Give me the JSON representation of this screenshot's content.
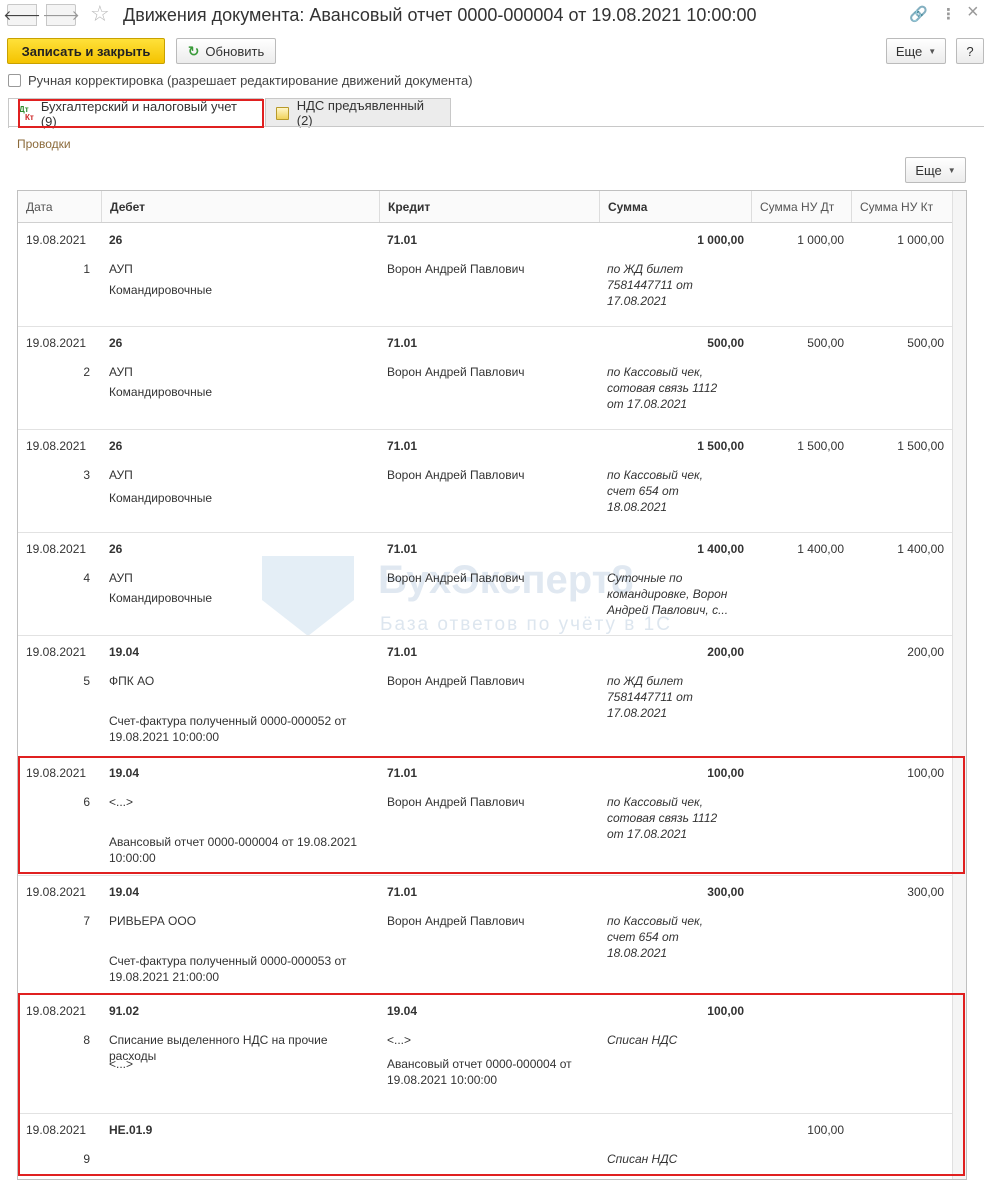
{
  "window": {
    "title": "Движения документа: Авансовый отчет 0000-000004 от 19.08.2021 10:00:00",
    "back_icon": "🡐",
    "forward_icon": "🡒",
    "star_icon": "☆",
    "link_icon": "🔗",
    "menu_icon": "⋮",
    "close_icon": "×"
  },
  "toolbar": {
    "save_close_label": "Записать и закрыть",
    "refresh_icon": "↻",
    "refresh_label": "Обновить",
    "more_label": "Еще",
    "help_label": "?"
  },
  "manual": {
    "label": "Ручная корректировка (разрешает редактирование движений документа)",
    "checked": false
  },
  "tabs": [
    {
      "label": "Бухгалтерский и налоговый учет (9)",
      "icon_dt": "Дт",
      "icon_kt": "Кт",
      "active": true
    },
    {
      "label": "НДС предъявленный (2)",
      "active": false
    }
  ],
  "section": {
    "title": "Проводки",
    "more_label": "Еще"
  },
  "table": {
    "columns": [
      "Дата",
      "Дебет",
      "Кредит",
      "Сумма",
      "Сумма НУ Дт",
      "Сумма НУ Кт"
    ],
    "rows": [
      {
        "date": "19.08.2021",
        "num": "1",
        "debit": "26",
        "debit_sub1": "АУП",
        "debit_sub2": "Командировочные",
        "credit": "71.01",
        "credit_sub1": "Ворон Андрей Павлович",
        "credit_sub2": "",
        "sum": "1 000,00",
        "sum_nu_dt": "1 000,00",
        "sum_nu_kt": "1 000,00",
        "content": " по ЖД билет 7581447711 от 17.08.2021"
      },
      {
        "date": "19.08.2021",
        "num": "2",
        "debit": "26",
        "debit_sub1": "АУП",
        "debit_sub2": "Командировочные",
        "credit": "71.01",
        "credit_sub1": "Ворон Андрей Павлович",
        "credit_sub2": "",
        "sum": "500,00",
        "sum_nu_dt": "500,00",
        "sum_nu_kt": "500,00",
        "content": " по Кассовый чек, сотовая связь 1112 от 17.08.2021"
      },
      {
        "date": "19.08.2021",
        "num": "3",
        "debit": "26",
        "debit_sub1": "АУП",
        "debit_sub2": "Командировочные",
        "credit": "71.01",
        "credit_sub1": "Ворон Андрей Павлович",
        "credit_sub2": "",
        "sum": "1 500,00",
        "sum_nu_dt": "1 500,00",
        "sum_nu_kt": "1 500,00",
        "content": " по Кассовый чек, счет 654 от 18.08.2021"
      },
      {
        "date": "19.08.2021",
        "num": "4",
        "debit": "26",
        "debit_sub1": "АУП",
        "debit_sub2": "Командировочные",
        "credit": "71.01",
        "credit_sub1": "Ворон Андрей Павлович",
        "credit_sub2": "",
        "sum": "1 400,00",
        "sum_nu_dt": "1 400,00",
        "sum_nu_kt": "1 400,00",
        "content": "Суточные по командировке, Ворон Андрей Павлович, с..."
      },
      {
        "date": "19.08.2021",
        "num": "5",
        "debit": "19.04",
        "debit_sub1": "ФПК АО",
        "debit_sub2": "Счет-фактура полученный 0000-000052 от 19.08.2021 10:00:00",
        "credit": "71.01",
        "credit_sub1": "Ворон Андрей Павлович",
        "credit_sub2": "",
        "sum": "200,00",
        "sum_nu_dt": "",
        "sum_nu_kt": "200,00",
        "content": "по ЖД билет 7581447711 от 17.08.2021"
      },
      {
        "date": "19.08.2021",
        "num": "6",
        "debit": "19.04",
        "debit_sub1": "<...>",
        "debit_sub2": "Авансовый отчет 0000-000004 от 19.08.2021 10:00:00",
        "credit": "71.01",
        "credit_sub1": "Ворон Андрей Павлович",
        "credit_sub2": "",
        "sum": "100,00",
        "sum_nu_dt": "",
        "sum_nu_kt": "100,00",
        "content": "по Кассовый чек, сотовая связь 1112 от 17.08.2021"
      },
      {
        "date": "19.08.2021",
        "num": "7",
        "debit": "19.04",
        "debit_sub1": "РИВЬЕРА ООО",
        "debit_sub2": "Счет-фактура полученный 0000-000053 от 19.08.2021 21:00:00",
        "credit": "71.01",
        "credit_sub1": "Ворон Андрей Павлович",
        "credit_sub2": "",
        "sum": "300,00",
        "sum_nu_dt": "",
        "sum_nu_kt": "300,00",
        "content": "по Кассовый чек, счет 654 от 18.08.2021"
      },
      {
        "date": "19.08.2021",
        "num": "8",
        "debit": "91.02",
        "debit_sub1": "Списание выделенного НДС на прочие расходы",
        "debit_sub2": "<...>",
        "credit": "19.04",
        "credit_sub1": "<...>",
        "credit_sub2": "Авансовый отчет 0000-000004 от 19.08.2021 10:00:00",
        "sum": "100,00",
        "sum_nu_dt": "",
        "sum_nu_kt": "",
        "content": "Списан НДС"
      },
      {
        "date": "19.08.2021",
        "num": "9",
        "debit": "НЕ.01.9",
        "debit_sub1": "",
        "debit_sub2": "",
        "credit": "",
        "credit_sub1": "",
        "credit_sub2": "",
        "sum": "",
        "sum_nu_dt": "100,00",
        "sum_nu_kt": "",
        "content": "Списан НДС"
      }
    ]
  },
  "watermark": {
    "title": "БухЭксперт8",
    "subtitle": "База ответов по учёту в 1С"
  }
}
